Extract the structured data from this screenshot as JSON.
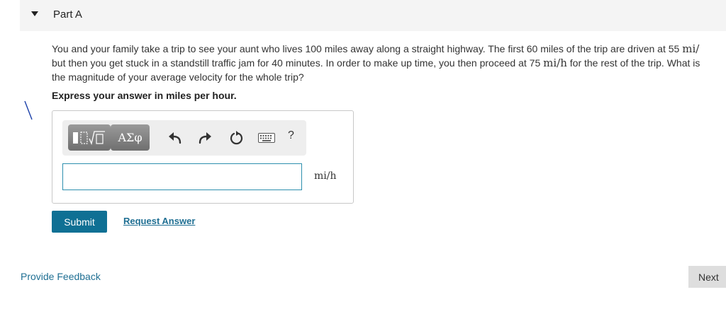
{
  "part": {
    "title": "Part A"
  },
  "question": {
    "line1_a": "You and your family take a trip to see your aunt who lives 100 miles away along a straight highway. The first 60 miles of the trip are driven at 55 ",
    "line1_unit": "mi/",
    "line2_a": "but then you get stuck in a standstill traffic jam for 40 minutes. In order to make up time, you then proceed at 75 ",
    "line2_unit": "mi/h",
    "line2_b": " for the rest of the trip. What is",
    "line3": "the magnitude of your average velocity for the whole trip?",
    "instruction": "Express your answer in miles per hour."
  },
  "toolbar": {
    "templates_icon": "templates-icon",
    "symbols_label": "ΑΣφ",
    "undo_icon": "undo-icon",
    "redo_icon": "redo-icon",
    "reset_icon": "reset-icon",
    "keyboard_icon": "keyboard-icon",
    "help_label": "?"
  },
  "answer": {
    "value": "",
    "unit": "mi/h"
  },
  "actions": {
    "submit_label": "Submit",
    "request_answer_label": "Request Answer"
  },
  "footer": {
    "feedback_label": "Provide Feedback",
    "next_label": "Next"
  },
  "colors": {
    "accent": "#0f7094",
    "link": "#1f6f93",
    "input_border": "#2d8fae"
  }
}
